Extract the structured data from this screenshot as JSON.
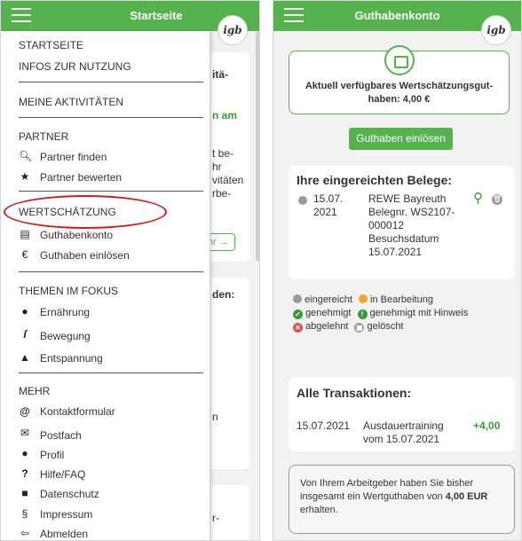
{
  "left_screen": {
    "title": "Startseite",
    "logo": "igb",
    "background": {
      "card1_text1": "itä-",
      "card1_text2": "n am",
      "card1_text3": "t be-",
      "card1_text4": "hr",
      "card1_text5": "vitäten",
      "card1_text6": "rbe-",
      "card1_button": "hr →",
      "card2_text1": "den:",
      "card2_text2": "n",
      "card3_text1": "r-"
    },
    "menu": {
      "startseite": "STARTSEITE",
      "infos": "INFOS ZUR NUTZUNG",
      "meine_aktivitaeten": "MEINE AKTIVITÄTEN",
      "partner": "PARTNER",
      "partner_finden": "Partner finden",
      "partner_bewerten": "Partner bewerten",
      "wertschaetzung": "WERTSCHÄTZUNG",
      "guthabenkonto": "Guthabenkonto",
      "guthaben_einloesen": "Guthaben einlösen",
      "themen_im_fokus": "THEMEN IM FOKUS",
      "ernaehrung": "Ernährung",
      "bewegung": "Bewegung",
      "entspannung": "Entspannung",
      "mehr": "MEHR",
      "kontaktformular": "Kontaktformular",
      "postfach": "Postfach",
      "profil": "Profil",
      "hilfe": "Hilfe/FAQ",
      "datenschutz": "Datenschutz",
      "impressum": "Impressum",
      "abmelden": "Abmelden"
    },
    "icons": {
      "search": "search-icon",
      "star": "star-icon",
      "ledger": "ledger-icon",
      "euro": "euro-icon",
      "apple": "apple-icon",
      "running": "running-icon",
      "relax": "relax-icon",
      "at": "at-icon",
      "mail": "mail-icon",
      "user": "user-icon",
      "question": "question-icon",
      "lock": "lock-icon",
      "paragraph": "paragraph-icon",
      "logout": "logout-icon"
    }
  },
  "right_screen": {
    "title": "Guthabenkonto",
    "logo": "igb",
    "balance_text": "Aktuell verfügbares Wertschätzungsgut-haben: 4,00 €",
    "redeem_button": "Guthaben einlösen",
    "receipts": {
      "title": "Ihre eingereichten Belege:",
      "items": [
        {
          "date": "15.07. 2021",
          "partner": "REWE Bayreuth",
          "belegnr": "Belegnr. WS2107-000012",
          "besuch": "Besuchsdatum 15.07.2021",
          "status": "eingereicht"
        }
      ]
    },
    "legend": {
      "eingereicht": "eingereicht",
      "in_bearbeitung": "in Bearbeitung",
      "genehmigt": "genehmigt",
      "genehmigt_hinweis": "genehmigt mit Hinweis",
      "abgelehnt": "abgelehnt",
      "geloescht": "gelöscht"
    },
    "transactions": {
      "title": "Alle Transaktionen:",
      "items": [
        {
          "date": "15.07.2021",
          "description": "Ausdauertraining vom 15.07.2021",
          "amount": "+4,00"
        }
      ]
    },
    "info": {
      "text_before": "Von Ihrem Arbeitgeber haben Sie bisher insgesamt ein Wertguthaben von ",
      "amount": "4,00 EUR",
      "text_after": " erhalten."
    }
  },
  "colors": {
    "brand_green": "#55b34e",
    "highlight_red": "#d11a1a",
    "status_gray": "#9a9a9a",
    "status_orange": "#f5a623",
    "status_green": "#3a9a36",
    "status_red": "#d9534f"
  }
}
